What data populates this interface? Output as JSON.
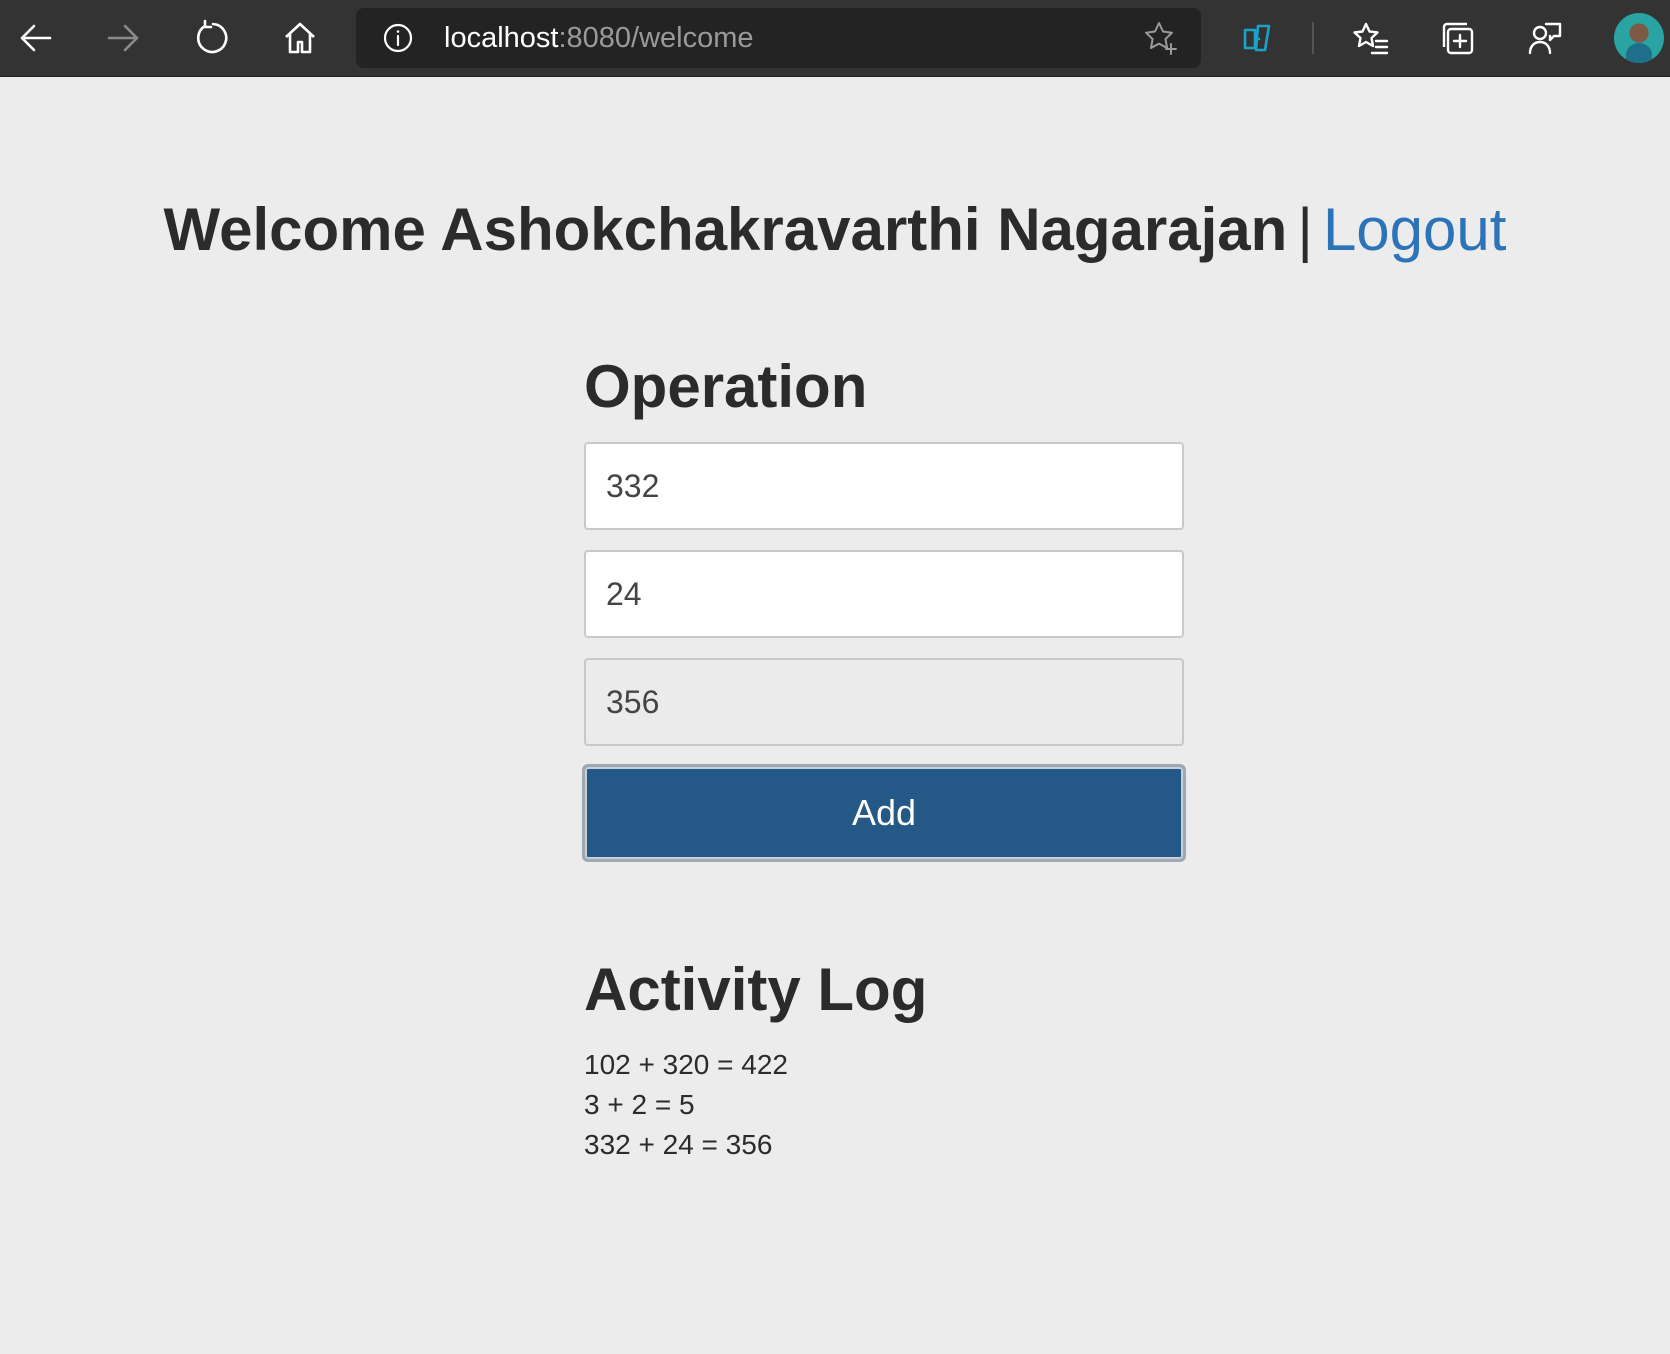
{
  "browser": {
    "url_host": "localhost",
    "url_path": ":8080/welcome",
    "icons": {
      "back": "back-arrow-icon",
      "forward": "forward-arrow-icon",
      "reload": "reload-icon",
      "home": "home-icon",
      "info": "info-icon",
      "favorite": "star-plus-icon",
      "extension": "extension-icon",
      "favorites": "favorites-list-icon",
      "collections": "collections-icon",
      "feedback": "feedback-icon",
      "profile": "avatar"
    }
  },
  "header": {
    "welcome_text": "Welcome Ashokchakravarthi Nagarajan",
    "separator": "|",
    "logout_label": "Logout"
  },
  "operation": {
    "title": "Operation",
    "first_value": "332",
    "second_value": "24",
    "result_value": "356",
    "add_label": "Add"
  },
  "activity": {
    "title": "Activity Log",
    "entries": [
      "102 + 320 = 422",
      "3 + 2 = 5",
      "332 + 24 = 356"
    ]
  },
  "colors": {
    "accent": "#245886",
    "link": "#2d73b8",
    "page_background": "#ececec",
    "toolbar_background": "#333333"
  }
}
